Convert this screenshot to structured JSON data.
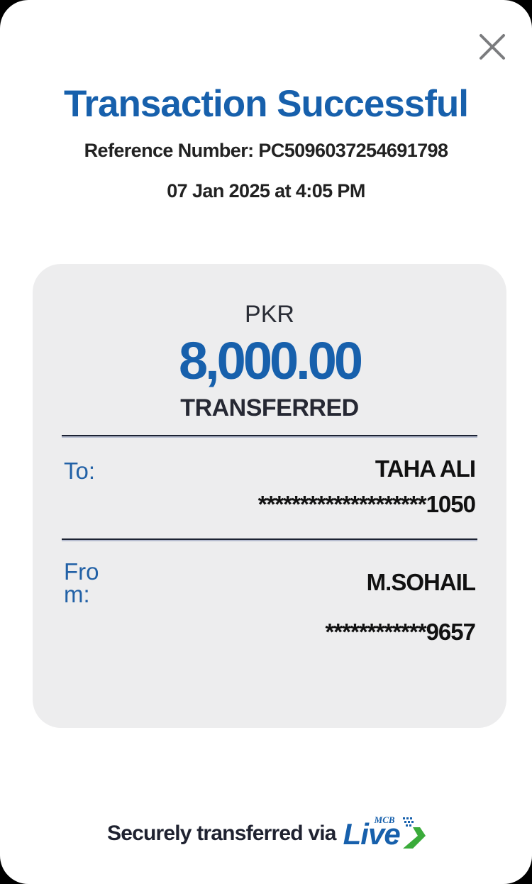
{
  "header": {
    "title": "Transaction Successful",
    "reference": "Reference Number: PC5096037254691798",
    "datetime": "07 Jan 2025 at 4:05 PM"
  },
  "summary": {
    "currency": "PKR",
    "amount": "8,000.00",
    "status": "TRANSFERRED"
  },
  "recipient": {
    "label": "To:",
    "name": "TAHA ALI",
    "account": "********************1050"
  },
  "sender": {
    "label": "From:",
    "name": "M.SOHAIL",
    "account": "************9657"
  },
  "footer": {
    "text": "Securely transferred via",
    "brand_main": "Live",
    "brand_small": "MCB"
  },
  "colors": {
    "accent": "#1760ac",
    "card": "#ededee",
    "logo_green": "#3aab3a"
  },
  "icons": {
    "close": "close-icon"
  }
}
